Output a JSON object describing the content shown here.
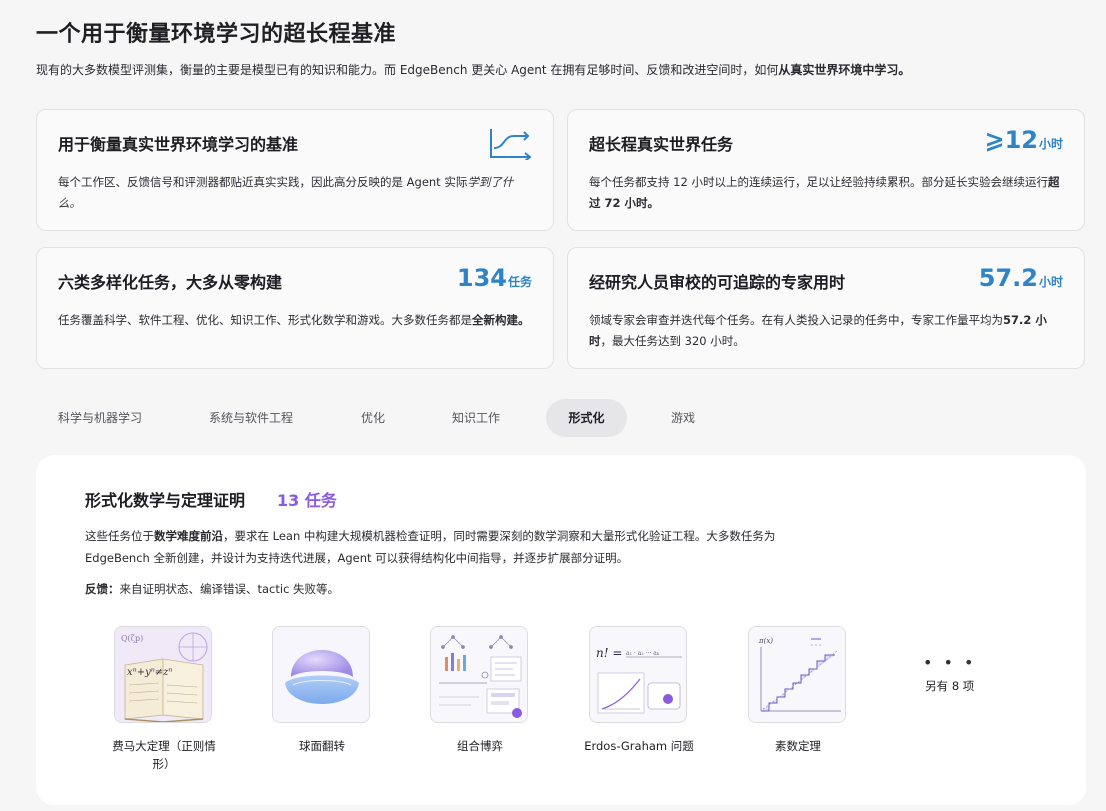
{
  "header": {
    "title": "一个用于衡量环境学习的超长程基准",
    "intro_text": "现有的大多数模型评测集，衡量的主要是模型已有的知识和能力。而 EdgeBench 更关心 Agent 在拥有足够时间、反馈和改进空间时，如何",
    "intro_bold": "从真实世界环境中学习。"
  },
  "cards": {
    "real_env": {
      "title": "用于衡量真实世界环境学习的基准",
      "desc_text": "每个工作区、反馈信号和评测器都贴近真实实践，因此高分反映的是 Agent 实际",
      "desc_italic": "学到了什么。",
      "icon": "learning-curve-icon"
    },
    "long_horizon": {
      "title": "超长程真实世界任务",
      "stat_num": "⩾12",
      "stat_unit": "小时",
      "desc_text": "每个任务都支持 12 小时以上的连续运行，足以让经验持续累积。部分延长实验会继续运行",
      "desc_bold": "超过 72 小时。"
    },
    "diverse": {
      "title": "六类多样化任务，大多从零构建",
      "stat_num": "134",
      "stat_unit": "任务",
      "desc_text": "任务覆盖科学、软件工程、优化、知识工作、形式化数学和游戏。大多数任务都是",
      "desc_bold": "全新构建。"
    },
    "expert": {
      "title": "经研究人员审校的可追踪的专家用时",
      "stat_num": "57.2",
      "stat_unit": "小时",
      "desc_text": "领域专家会审查并迭代每个任务。在有人类投入记录的任务中，专家工作量平均为",
      "desc_bold": "57.2 小时",
      "desc_tail": "，最大任务达到 320 小时。"
    }
  },
  "tabs": [
    {
      "label": "科学与机器学习"
    },
    {
      "label": "系统与软件工程"
    },
    {
      "label": "优化"
    },
    {
      "label": "知识工作"
    },
    {
      "label": "形式化"
    },
    {
      "label": "游戏"
    }
  ],
  "active_tab": "形式化",
  "panel": {
    "title": "形式化数学与定理证明",
    "count": "13 任务",
    "desc_pre": "这些任务位于",
    "desc_bold": "数学难度前沿",
    "desc_post": "，要求在 Lean 中构建大规模机器检查证明，同时需要深刻的数学洞察和大量形式化验证工程。大多数任务为 EdgeBench 全新创建，并设计为支持迭代进展，Agent 可以获得结构化中间指导，并逐步扩展部分证明。",
    "feedback_label": "反馈：",
    "feedback_text": "来自证明状态、编译错误、tactic 失败等。",
    "items": [
      {
        "label": "费马大定理（正则情形）",
        "icon": "fermat-notebook-icon"
      },
      {
        "label": "球面翻转",
        "icon": "sphere-eversion-icon"
      },
      {
        "label": "组合博弈",
        "icon": "game-tree-icon"
      },
      {
        "label": "Erdos-Graham 问题",
        "icon": "factorial-formula-icon"
      },
      {
        "label": "素数定理",
        "icon": "prime-count-chart-icon"
      }
    ],
    "more_dots": "• • •",
    "more_label": "另有 8 项"
  },
  "colors": {
    "accent_blue": "#2f84c8",
    "accent_purple": "#8a5ae0",
    "background": "#f6f6f7"
  }
}
